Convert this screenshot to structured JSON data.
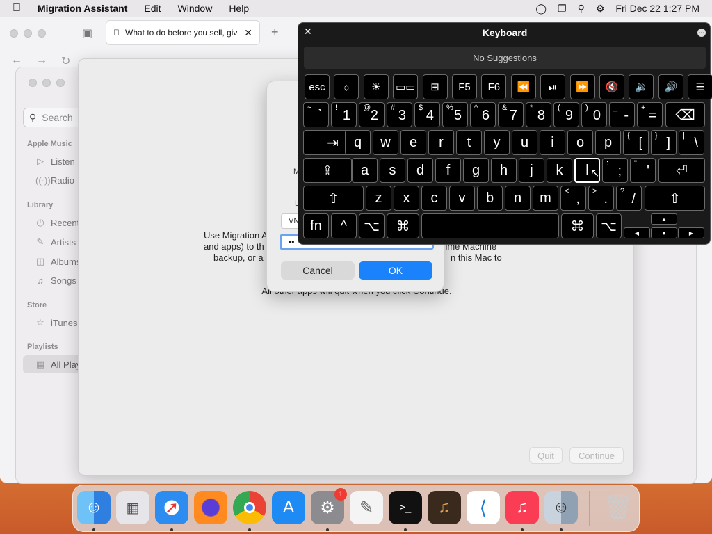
{
  "menubar": {
    "app": "Migration Assistant",
    "items": [
      "Edit",
      "Window",
      "Help"
    ],
    "clock": "Fri Dec 22  1:27 PM"
  },
  "safari": {
    "tab_title": "What to do before you sell, give"
  },
  "music": {
    "search_placeholder": "Search",
    "sections": {
      "apple_music": "Apple Music",
      "library": "Library",
      "store": "Store",
      "playlists": "Playlists"
    },
    "items": {
      "listen": "Listen",
      "radio": "Radio",
      "recent": "Recent",
      "artists": "Artists",
      "albums": "Albums",
      "songs": "Songs",
      "itunes": "iTunes",
      "all_playlists": "All Play"
    }
  },
  "migration": {
    "line1_left": "Use Migration A",
    "line2_left": "and apps) to th",
    "line2_right": "Time Machine",
    "line3_left": "backup, or a",
    "line3_right": "n this Mac to",
    "line4": "All other apps will quit when you click Continue.",
    "quit_label": "Quit",
    "continue_label": "Continue"
  },
  "dialog": {
    "frag_m": "M",
    "frag_l": "L",
    "frag_vn": "VN",
    "password_dots": "••",
    "cancel_label": "Cancel",
    "ok_label": "OK"
  },
  "keyboard": {
    "title": "Keyboard",
    "suggestions": "No Suggestions",
    "fn_row": [
      "esc",
      "☼",
      "☀",
      "▭▭",
      "⊞",
      "F5",
      "F6",
      "⏪",
      "⏯",
      "⏩",
      "🔇",
      "🔉",
      "🔊",
      "☰"
    ],
    "number_row": [
      [
        "~",
        "`"
      ],
      [
        "!",
        "1"
      ],
      [
        "@",
        "2"
      ],
      [
        "#",
        "3"
      ],
      [
        "$",
        "4"
      ],
      [
        "%",
        "5"
      ],
      [
        "^",
        "6"
      ],
      [
        "&",
        "7"
      ],
      [
        "*",
        "8"
      ],
      [
        "(",
        "9"
      ],
      [
        ")",
        "0"
      ],
      [
        "_",
        "-"
      ],
      [
        "+",
        "="
      ]
    ],
    "qwerty_row": [
      "q",
      "w",
      "e",
      "r",
      "t",
      "y",
      "u",
      "i",
      "o",
      "p"
    ],
    "brackets": [
      [
        "{",
        "["
      ],
      [
        "}",
        "]"
      ],
      [
        "|",
        "\\"
      ]
    ],
    "home_row": [
      "a",
      "s",
      "d",
      "f",
      "g",
      "h",
      "j",
      "k",
      "l"
    ],
    "home_punct": [
      [
        ":",
        ";"
      ],
      [
        "\"",
        "'"
      ]
    ],
    "bottom_row": [
      "z",
      "x",
      "c",
      "v",
      "b",
      "n",
      "m"
    ],
    "bottom_punct": [
      [
        "<",
        ","
      ],
      [
        ">",
        "."
      ],
      [
        "?",
        "/"
      ]
    ],
    "fn_label": "fn",
    "ctrl_label": "^",
    "opt_label": "⌥",
    "cmd_label": "⌘",
    "arrows": [
      "▲",
      "◀",
      "▼",
      "▶"
    ]
  },
  "dock": {
    "settings_badge": "1"
  }
}
